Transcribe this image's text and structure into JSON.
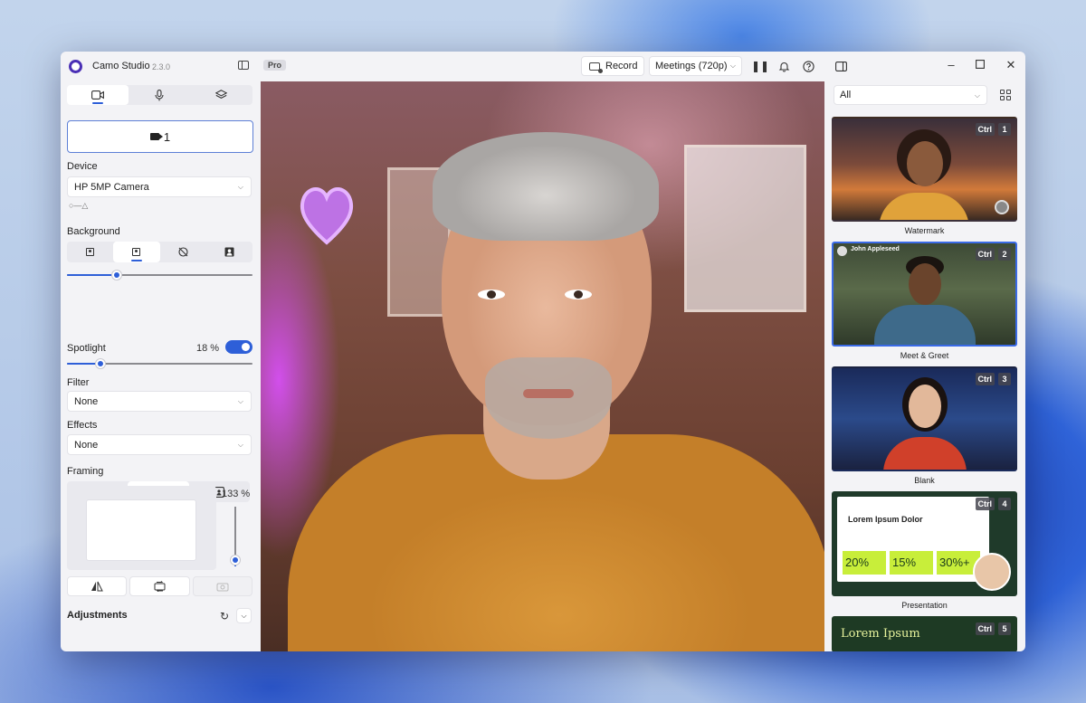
{
  "app": {
    "name": "Camo Studio",
    "version": "2.3.0",
    "badge": "Pro"
  },
  "toolbar": {
    "record_label": "Record",
    "preset_value": "Meetings (720p)"
  },
  "left": {
    "camera_source_label": "1",
    "device_label": "Device",
    "device_value": "HP 5MP Camera",
    "background_label": "Background",
    "background_blur": 0.27,
    "spotlight_label": "Spotlight",
    "spotlight_value": "18 %",
    "spotlight_level": 0.18,
    "filter_label": "Filter",
    "filter_value": "None",
    "effects_label": "Effects",
    "effects_value": "None",
    "framing_label": "Framing",
    "zoom_value": "133 %",
    "zoom_level": 0.1,
    "adjustments_label": "Adjustments"
  },
  "right": {
    "filter_value": "All",
    "scenes": [
      {
        "name": "Watermark",
        "ctrl": "Ctrl",
        "num": "1"
      },
      {
        "name": "Meet & Greet",
        "ctrl": "Ctrl",
        "num": "2",
        "overlay_name": "John Appleseed"
      },
      {
        "name": "Blank",
        "ctrl": "Ctrl",
        "num": "3"
      },
      {
        "name": "Presentation",
        "ctrl": "Ctrl",
        "num": "4",
        "slide_title": "Lorem Ipsum Dolor",
        "stats": [
          "20%",
          "15%",
          "30%+"
        ]
      },
      {
        "name": "",
        "ctrl": "Ctrl",
        "num": "5",
        "slide_title": "Lorem Ipsum"
      }
    ]
  },
  "colors": {
    "accent": "#2e5fd8",
    "brand": "#4a2fb5"
  }
}
